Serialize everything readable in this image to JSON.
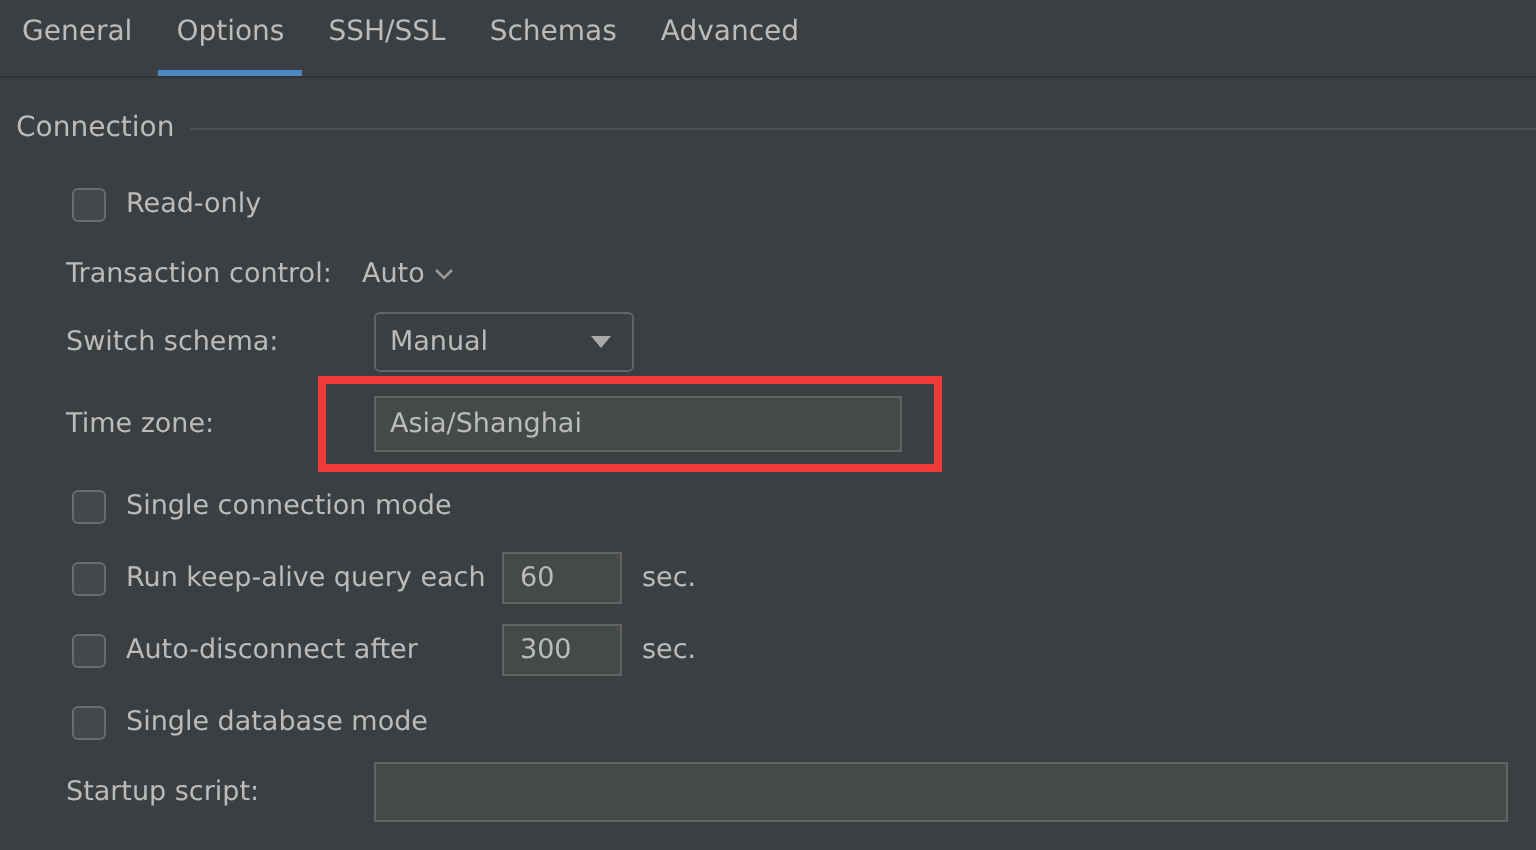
{
  "tabs": [
    {
      "label": "General",
      "selected": false
    },
    {
      "label": "Options",
      "selected": true
    },
    {
      "label": "SSH/SSL",
      "selected": false
    },
    {
      "label": "Schemas",
      "selected": false
    },
    {
      "label": "Advanced",
      "selected": false
    }
  ],
  "section": {
    "title": "Connection"
  },
  "rows": [
    {
      "kind": "checkbox",
      "label": "Read-only",
      "checked": false
    },
    {
      "kind": "link-select",
      "label": "Transaction control:",
      "value": "Auto"
    },
    {
      "kind": "dropdown",
      "label": "Switch schema:",
      "value": "Manual"
    },
    {
      "kind": "text",
      "label": "Time zone:",
      "value": "Asia/Shanghai",
      "highlighted": true
    },
    {
      "kind": "checkbox",
      "label": "Single connection mode",
      "checked": false
    },
    {
      "kind": "checkbox-number",
      "label": "Run keep-alive query each",
      "checked": false,
      "value": "60",
      "unit": "sec."
    },
    {
      "kind": "checkbox-number",
      "label": "Auto-disconnect after",
      "checked": false,
      "value": "300",
      "unit": "sec."
    },
    {
      "kind": "checkbox",
      "label": "Single database mode",
      "checked": false
    },
    {
      "kind": "script",
      "label": "Startup script:"
    }
  ]
}
